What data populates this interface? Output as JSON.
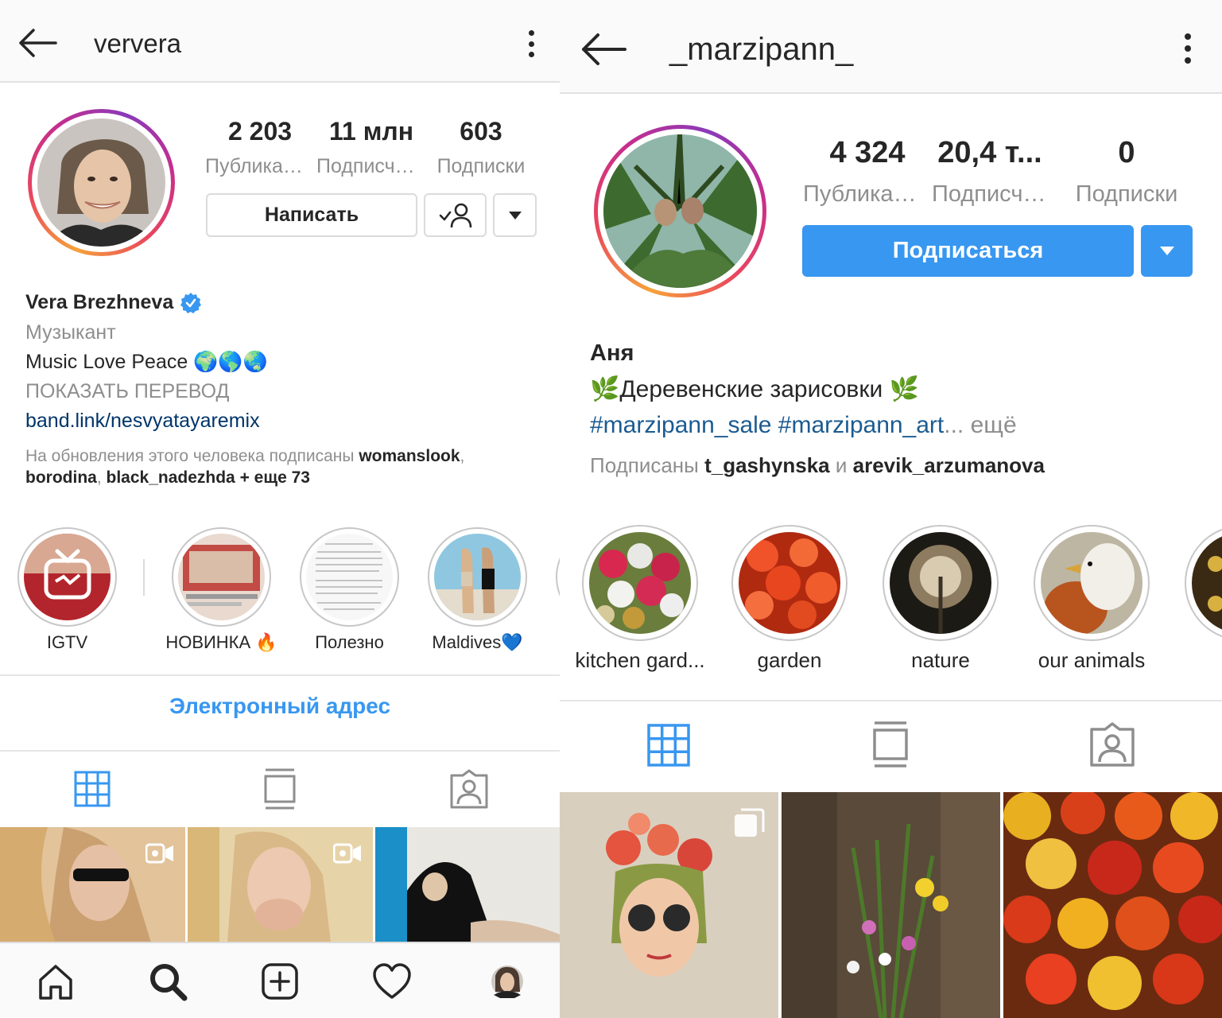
{
  "left": {
    "username": "ververa",
    "stats": [
      {
        "value": "2 203",
        "label": "Публикации"
      },
      {
        "value": "11 млн",
        "label": "Подписчики"
      },
      {
        "value": "603",
        "label": "Подписки"
      }
    ],
    "message_button": "Написать",
    "name": "Vera Brezhneva",
    "category": "Музыкант",
    "bio": "Music Love Peace 🌍🌎🌏",
    "translate": "ПОКАЗАТЬ ПЕРЕВОД",
    "link": "band.link/nesvyatayaremix",
    "followed_prefix": "На обновления этого человека подписаны ",
    "followed_user1": "womanslook",
    "followed_sep1": ",",
    "followed_user2": "borodina",
    "followed_sep2": ", ",
    "followed_user3": "black_nadezhda",
    "followed_more": " + еще 73",
    "highlights": [
      {
        "label": "IGTV"
      },
      {
        "label": "НОВИНКА 🔥"
      },
      {
        "label": "Полезно"
      },
      {
        "label": "Maldives💙"
      }
    ],
    "email_button": "Электронный адрес"
  },
  "right": {
    "username": "_marzipann_",
    "stats": [
      {
        "value": "4 324",
        "label": "Публикации"
      },
      {
        "value": "20,4 т...",
        "label": "Подписчики"
      },
      {
        "value": "0",
        "label": "Подписки"
      }
    ],
    "follow_button": "Подписаться",
    "name": "Аня",
    "bio": "🌿Деревенские зарисовки 🌿",
    "hashtags": "#marzipann_sale #marzipann_art",
    "more": "... ещё",
    "followed_prefix": "Подписаны ",
    "followed_user1": "t_gashynska",
    "followed_and": " и ",
    "followed_user2": "arevik_arzumanova",
    "highlights": [
      {
        "label": "kitchen gard..."
      },
      {
        "label": "garden"
      },
      {
        "label": "nature"
      },
      {
        "label": "our animals"
      }
    ]
  },
  "colors": {
    "accent": "#3897f0",
    "link": "#003569",
    "hashtag": "#1c5b91",
    "muted": "#8e8e8e",
    "verified": "#3897f0"
  }
}
